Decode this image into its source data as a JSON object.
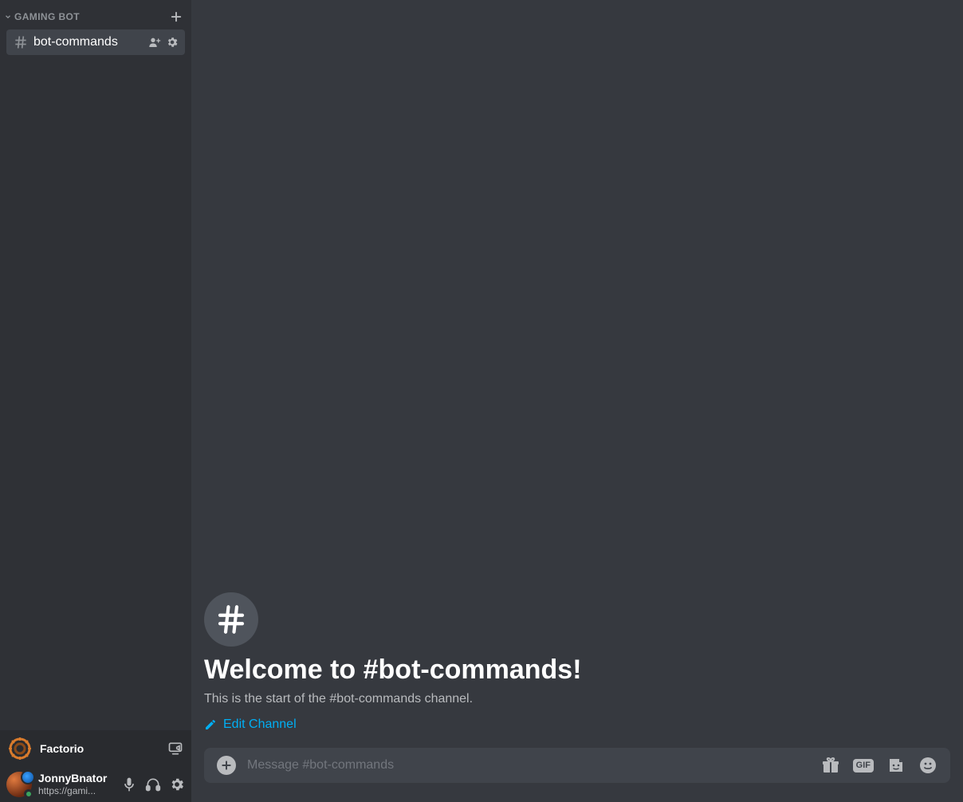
{
  "sidebar": {
    "category_label": "GAMING BOT",
    "channel": {
      "name": "bot-commands"
    },
    "activity": {
      "name": "Factorio"
    },
    "user": {
      "name": "JonnyBnator",
      "status": "https://gami..."
    }
  },
  "chat": {
    "welcome_title": "Welcome to #bot-commands!",
    "welcome_subtitle": "This is the start of the #bot-commands channel.",
    "edit_link": "Edit Channel"
  },
  "composer": {
    "placeholder": "Message #bot-commands",
    "gif_label": "GIF"
  }
}
